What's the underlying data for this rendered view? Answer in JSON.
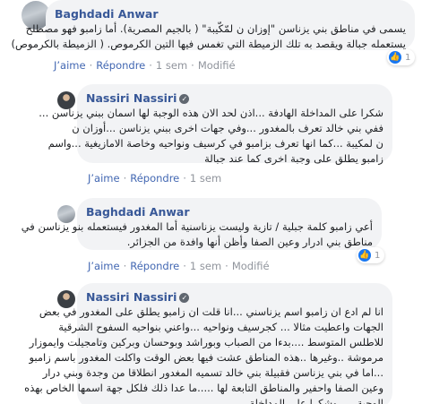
{
  "labels": {
    "like": "J’aime",
    "reply": "Répondre",
    "modified": "Modifié"
  },
  "comments": [
    {
      "author": "Baghdadi Anwar",
      "lines": [
        "يسمى في مناطق بني يزناسن \"إوزان ن لمّكّيبة\" ( بالجيم المصرية). أما زامبو فهو مصطلح",
        "يستعمله جبالة ويقصد به تلك الزميطة التي تغمس فيها التين الكرموص. ( الزميطة بالكرموص)"
      ],
      "time": "1 sem",
      "reactions": "1"
    },
    {
      "author": "Nassiri Nassiri",
      "lines": [
        "شكرا على المداخلة الهادفة ...اذن لحد الان هذه الوجبة لها اسمان ببني يزناسن ...",
        "ففي بني خالد تعرف بالمغدور ...وفي جهات اخرى ببني يزناسن ...أوزان ن",
        "ن لمكيبة ...كما انها تعرف بزامبو في كرسيف ونواحيه وخاصة الامازيغية ...واسم",
        "زامبو يطلق على وجبة اخرى كما عند جبالة"
      ],
      "time": "1 sem"
    },
    {
      "author": "Baghdadi Anwar",
      "lines": [
        "أعي زامبو كلمة جبلية / تازية وليست يزناسنية أما المغدور فيستعمله بنو يزناسن في",
        "مناطق بني ادرار وعين الصفا وأظن أنها وافدة من الجزائر."
      ],
      "time": "1 sem",
      "reactions": "1"
    },
    {
      "author": "Nassiri Nassiri",
      "lines": [
        "انا لم ادع ان زامبو اسم يزناسني ...انا قلت ان زامبو يطلق على المغدور في بعض",
        "الجهات واعطيت مثالا ... كجرسيف ونواحيه ...واعني بنواحيه السفوح الشرقية",
        "للاطلس المتوسط ....بدءا من الصباب وبوراشد وبوحسان وبركين وتامجيلت وايموزار",
        "مرموشة ..وغيرها ..هذه المناطق عشت فيها بعض الوقت واكلت المغدور باسم زامبو",
        "...اما في بني يزناسن فقبيلة بني خالد تسميه المغدور انطلاقا من وجدة وبني درار",
        "وعين الصفا واحفير والمناطق التابعة لها .....ما عدا ذلك فلكل جهة اسمها الخاص بهذه",
        "الوجبة .....وشكرا على المداخلة"
      ]
    }
  ]
}
